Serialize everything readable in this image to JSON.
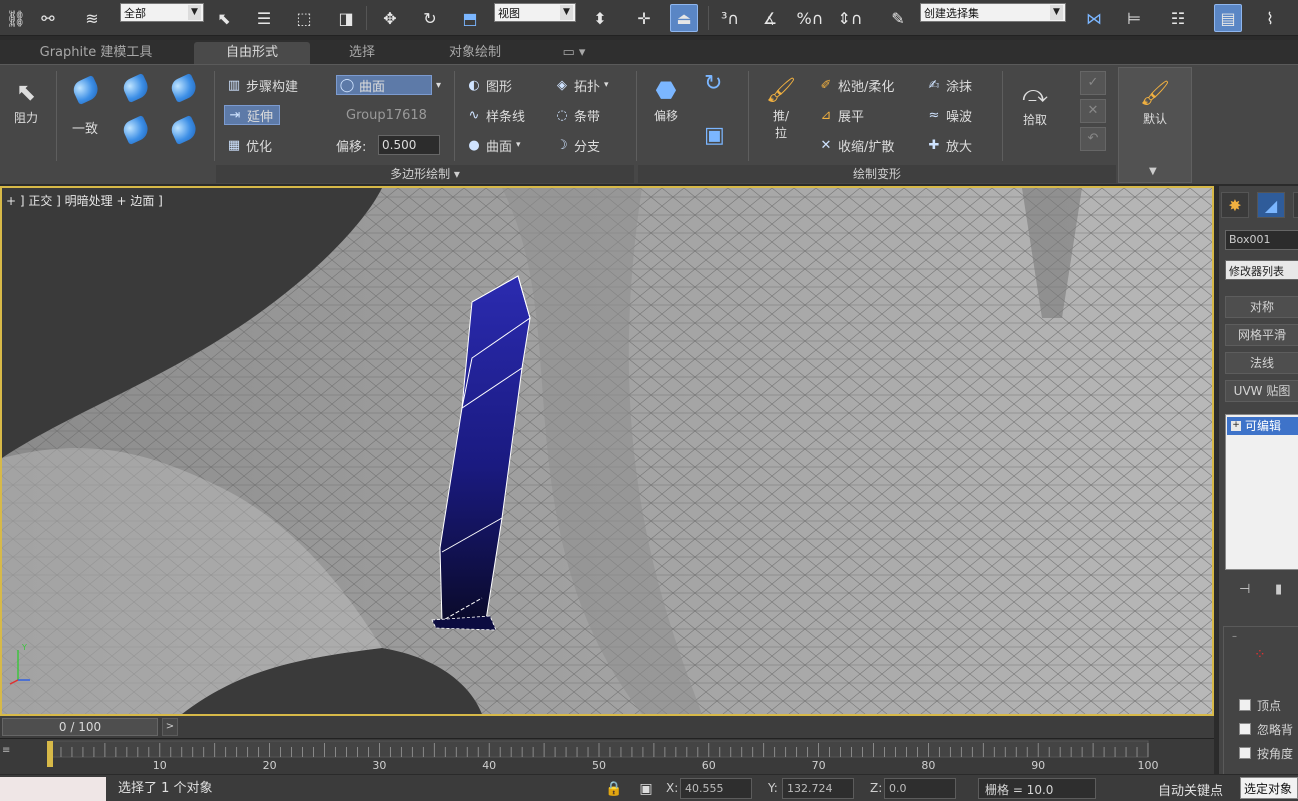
{
  "toolbar": {
    "selection_filter": "全部",
    "ref_coord": "视图",
    "named_selection": "创建选择集"
  },
  "ribbon_tabs": [
    {
      "label": "Graphite 建模工具"
    },
    {
      "label": "自由形式"
    },
    {
      "label": "选择"
    },
    {
      "label": "对象绘制"
    }
  ],
  "ribbon": {
    "resist_label": "阻力",
    "conform_label": "一致",
    "step_build": "步骤构建",
    "extend": "延伸",
    "optimize": "优化",
    "surface_dropdown": "曲面",
    "group_name": "Group17618",
    "offset_label": "偏移:",
    "offset_value": "0.500",
    "shapes": "图形",
    "splines": "样条线",
    "surface": "曲面",
    "topology": "拓扑",
    "strips": "条带",
    "branches": "分支",
    "offset_btn": "偏移",
    "push_pull": "推/拉",
    "relax_soften": "松弛/柔化",
    "smudge": "涂抹",
    "flatten": "展平",
    "noise": "噪波",
    "contract_expand": "收缩/扩散",
    "inflate": "放大",
    "pick": "拾取",
    "default": "默认",
    "group_polydraw": "多边形绘制",
    "group_paint_deform": "绘制变形"
  },
  "viewport": {
    "label": "+ ] 正交 ] 明暗处理 + 边面 ]"
  },
  "command_panel": {
    "object_name": "Box001",
    "modifier_list": "修改器列表",
    "buttons": [
      "对称",
      "网格平滑",
      "法线",
      "UVW 贴图"
    ],
    "stack_item": "可编辑",
    "checkboxes": [
      "顶点",
      "忽略背",
      "按角度"
    ]
  },
  "timeline": {
    "frame_counter": "0 / 100",
    "ticks": [
      "10",
      "20",
      "30",
      "40",
      "50",
      "60",
      "70",
      "80",
      "90",
      "100"
    ]
  },
  "status": {
    "message": "选择了 1 个对象",
    "x_label": "X:",
    "x_value": "40.555",
    "y_label": "Y:",
    "y_value": "132.724",
    "z_label": "Z:",
    "z_value": "0.0",
    "grid": "栅格 = 10.0",
    "auto_key": "自动关键点",
    "set_key": "选定对象"
  },
  "colors": {
    "viewport_border": "#d7b948",
    "selected_object": "#1a1a8a",
    "active_blue": "#5a86c5"
  }
}
